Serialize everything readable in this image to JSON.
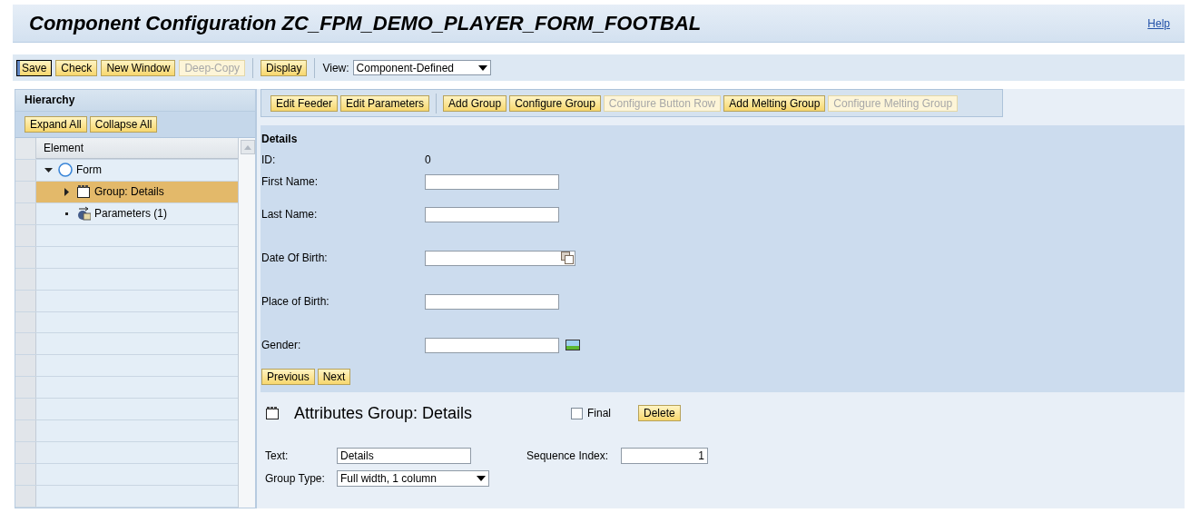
{
  "header": {
    "title": "Component Configuration ZC_FPM_DEMO_PLAYER_FORM_FOOTBAL",
    "help": "Help"
  },
  "toolbar": {
    "groups": [
      [
        {
          "label": "Save",
          "disabled": false,
          "focused": true
        },
        {
          "label": "Check",
          "disabled": false,
          "focused": false
        },
        {
          "label": "New Window",
          "disabled": false,
          "focused": false
        },
        {
          "label": "Deep-Copy",
          "disabled": true,
          "focused": false
        }
      ],
      [
        {
          "label": "Display",
          "disabled": false,
          "focused": false
        }
      ]
    ],
    "view_label": "View:",
    "view_value": "Component-Defined"
  },
  "hierarchy": {
    "title": "Hierarchy",
    "buttons": [
      "Expand All",
      "Collapse All"
    ],
    "column": "Element",
    "tree": [
      {
        "label": "Form",
        "kind": "form",
        "expanded": true,
        "selected": false,
        "children": [
          {
            "label": "Group: Details",
            "kind": "group",
            "expanded": false,
            "selected": true
          },
          {
            "label": "Parameters (1)",
            "kind": "parameters",
            "selected": false
          }
        ]
      }
    ]
  },
  "editor_toolbar": [
    [
      {
        "label": "Edit Feeder",
        "disabled": false
      },
      {
        "label": "Edit Parameters",
        "disabled": false
      }
    ],
    [
      {
        "label": "Add Group",
        "disabled": false
      },
      {
        "label": "Configure Group",
        "disabled": false
      },
      {
        "label": "Configure Button Row",
        "disabled": true
      },
      {
        "label": "Add Melting Group",
        "disabled": false
      },
      {
        "label": "Configure Melting Group",
        "disabled": true
      }
    ]
  ],
  "preview": {
    "title": "Details",
    "fields": [
      {
        "label": "ID:",
        "kind": "text",
        "value": "0"
      },
      {
        "label": "First Name:",
        "kind": "input"
      },
      {
        "label": "Last Name:",
        "kind": "input"
      },
      {
        "label": "Date Of Birth:",
        "kind": "date"
      },
      {
        "label": "Place of Birth:",
        "kind": "input"
      },
      {
        "label": "Gender:",
        "kind": "help"
      }
    ],
    "buttons": [
      "Previous",
      "Next"
    ]
  },
  "attributes": {
    "title": "Attributes Group: Details",
    "final": {
      "label": "Final",
      "checked": false
    },
    "delete": "Delete",
    "text_label": "Text:",
    "text_value": "Details",
    "sequence_label": "Sequence Index:",
    "sequence_value": "1",
    "group_type_label": "Group Type:",
    "group_type_value": "Full width, 1 column"
  }
}
